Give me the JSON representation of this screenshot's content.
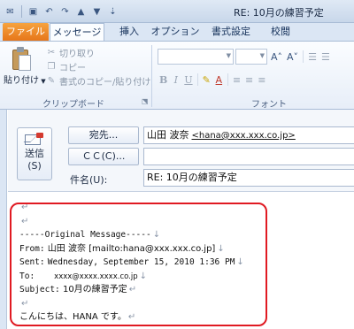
{
  "window": {
    "title": "RE: 10月の練習予定"
  },
  "quick_access": {
    "icons": [
      "app-icon",
      "save-icon",
      "undo-icon",
      "redo-icon",
      "up-icon",
      "down-icon",
      "customize-icon"
    ],
    "glyphs": {
      "app": "✉",
      "save": "▣",
      "undo": "↶",
      "redo": "↷",
      "up": "▲",
      "down": "▼",
      "customize": "⇣"
    }
  },
  "ribbon": {
    "tabs": [
      {
        "label": "ファイル",
        "color": "#e8771b"
      },
      {
        "label": "メッセージ",
        "active": true
      },
      {
        "label": "挿入"
      },
      {
        "label": "オプション"
      },
      {
        "label": "書式設定"
      },
      {
        "label": "校閲"
      }
    ],
    "clipboard": {
      "paste_label": "貼り付け",
      "cut_label": "切り取り",
      "copy_label": "コピー",
      "format_painter_label": "書式のコピー/貼り付け",
      "group_label": "クリップボード",
      "glyphs": {
        "cut": "✂",
        "copy": "❐",
        "painter": "✎"
      }
    },
    "font": {
      "group_label": "フォント",
      "grow_glyph": "A˄",
      "shrink_glyph": "A˅",
      "bold": "B",
      "italic": "I",
      "underline": "U",
      "align_glyphs": [
        "≡",
        "≡",
        "≡"
      ],
      "list_glyphs": [
        "☰",
        "☰"
      ],
      "highlight_glyph": "✎",
      "color_glyph": "A"
    },
    "launcher_glyph": "⬔"
  },
  "header": {
    "send_label": "送信",
    "send_accel": "(S)",
    "to_button": "宛先...",
    "cc_button": "ＣＣ(C)...",
    "subject_label": "件名(U):",
    "to_name": "山田 波奈",
    "to_address": "<hana@xxx.xxx.co.jp>",
    "cc_value": "",
    "subject_value": "RE: 10月の練習予定"
  },
  "body": {
    "paragraph_mark": "↵",
    "line_break_mark": "↓",
    "separator": "-----Original Message-----",
    "from_label": "From:",
    "from_value": "山田 波奈 [mailto:hana@xxx.xxx.co.jp]",
    "sent_label": "Sent:",
    "sent_value": "Wednesday, September 15, 2010 1:36 PM",
    "to_label": "To:",
    "to_value": "xxxx@xxxx.xxxx.co.jp",
    "subject_label": "Subject:",
    "subject_value": "10月の練習予定",
    "greeting": "こんにちは、HANA です。"
  },
  "colors": {
    "highlight": "#e01a22",
    "file_tab": "#e8771b",
    "ribbon_bg": "#dbe6f4"
  }
}
